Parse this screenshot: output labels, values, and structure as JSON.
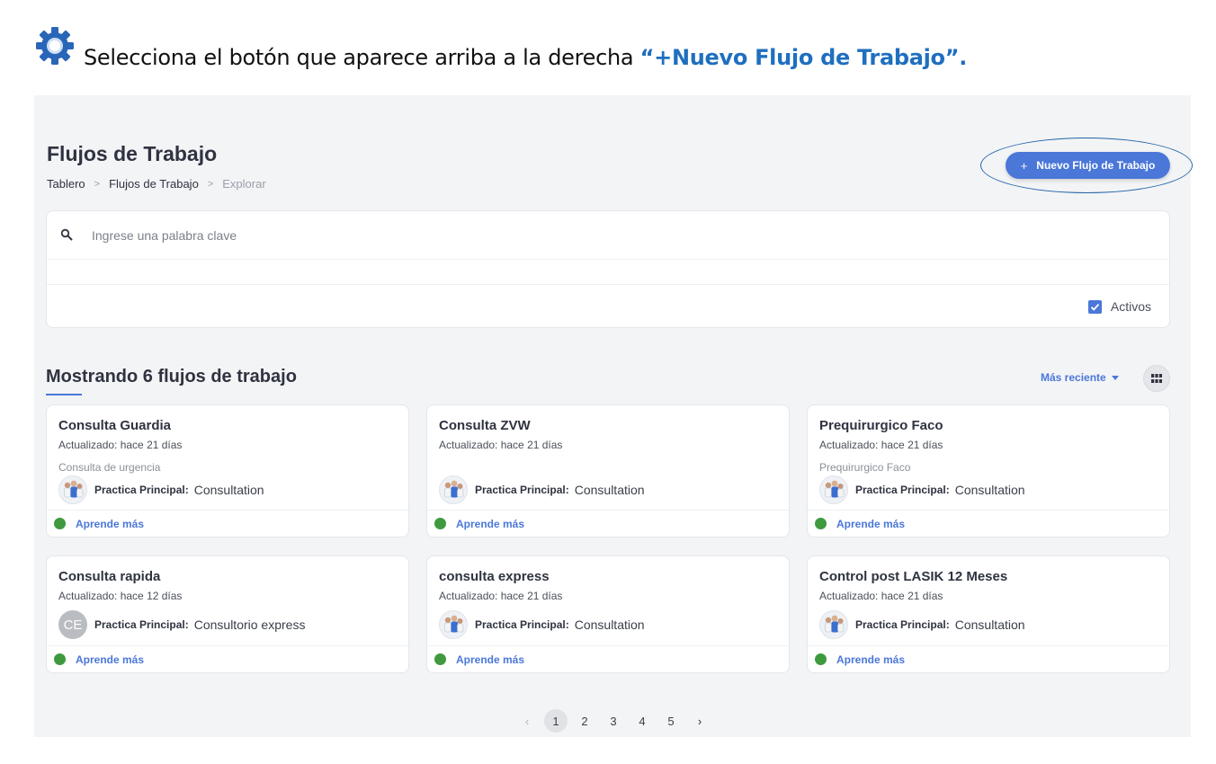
{
  "instruction": {
    "prefix": "Selecciona el botón que aparece arriba a la derecha ",
    "highlight": "“+Nuevo Flujo de Trabajo”."
  },
  "header": {
    "title": "Flujos de Trabajo",
    "breadcrumb": [
      "Tablero",
      "Flujos de Trabajo",
      "Explorar"
    ],
    "new_button_label": "Nuevo Flujo de Trabajo",
    "new_button_icon": "+"
  },
  "search": {
    "placeholder": "Ingrese una palabra clave",
    "value": "",
    "active_label": "Activos",
    "active_checked": true
  },
  "results": {
    "title": "Mostrando 6 flujos de trabajo",
    "sort_label": "Más reciente",
    "view_icon": "grid-icon"
  },
  "cards": [
    {
      "title": "Consulta Guardia",
      "updated": "Actualizado: hace 21 días",
      "desc": "Consulta de urgencia",
      "practice_label": "Practica Principal:",
      "practice_value": "Consultation",
      "avatar": "image",
      "initials": "",
      "learn": "Aprende más",
      "status_color": "#3f9a3f"
    },
    {
      "title": "Consulta ZVW",
      "updated": "Actualizado: hace 21 días",
      "desc": "",
      "practice_label": "Practica Principal:",
      "practice_value": "Consultation",
      "avatar": "image",
      "initials": "",
      "learn": "Aprende más",
      "status_color": "#3f9a3f"
    },
    {
      "title": "Prequirurgico Faco",
      "updated": "Actualizado: hace 21 días",
      "desc": "Prequirurgico Faco",
      "practice_label": "Practica Principal:",
      "practice_value": "Consultation",
      "avatar": "image",
      "initials": "",
      "learn": "Aprende más",
      "status_color": "#3f9a3f"
    },
    {
      "title": "Consulta rapida",
      "updated": "Actualizado: hace 12 días",
      "desc": "",
      "practice_label": "Practica Principal:",
      "practice_value": "Consultorio express",
      "avatar": "initials",
      "initials": "CE",
      "learn": "Aprende más",
      "status_color": "#3f9a3f"
    },
    {
      "title": "consulta express",
      "updated": "Actualizado: hace 21 días",
      "desc": "",
      "practice_label": "Practica Principal:",
      "practice_value": "Consultation",
      "avatar": "image",
      "initials": "",
      "learn": "Aprende más",
      "status_color": "#3f9a3f"
    },
    {
      "title": "Control post LASIK 12 Meses",
      "updated": "Actualizado: hace 21 días",
      "desc": "",
      "practice_label": "Practica Principal:",
      "practice_value": "Consultation",
      "avatar": "image",
      "initials": "",
      "learn": "Aprende más",
      "status_color": "#3f9a3f"
    }
  ],
  "pagination": {
    "pages": [
      "1",
      "2",
      "3",
      "4",
      "5"
    ],
    "current": "1"
  },
  "colors": {
    "accent": "#4a77d8",
    "highlight_text": "#1f6fbf",
    "status_active": "#3f9a3f"
  }
}
